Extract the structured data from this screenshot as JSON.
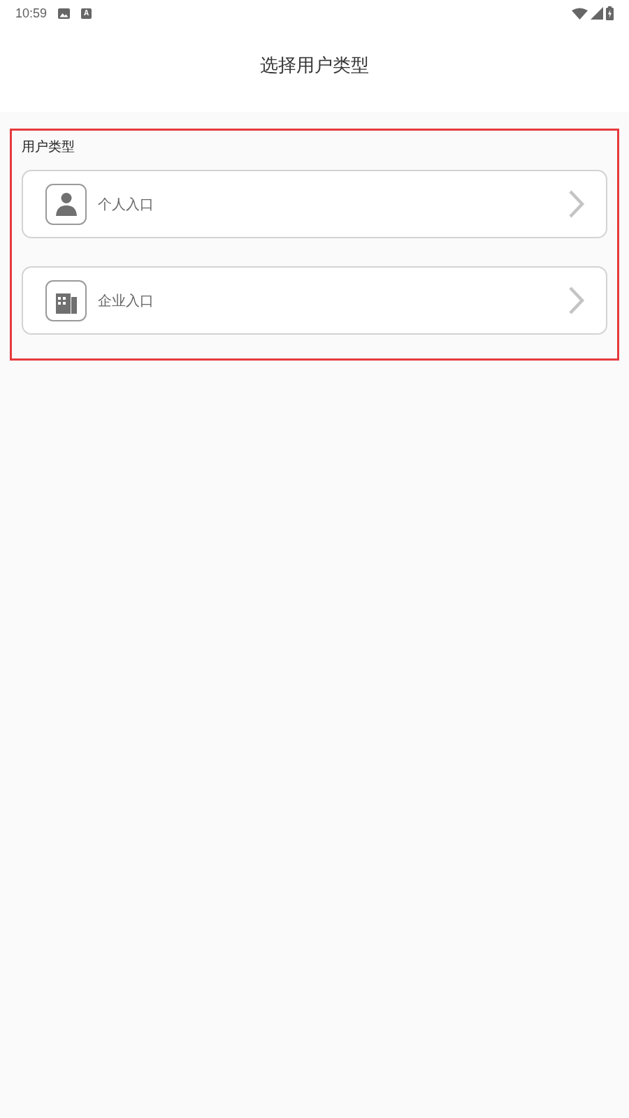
{
  "status_bar": {
    "time": "10:59",
    "notifications": [
      {
        "kind": "picture"
      },
      {
        "kind": "letter",
        "text": "A"
      }
    ]
  },
  "header": {
    "title": "选择用户类型"
  },
  "section": {
    "title": "用户类型",
    "options": [
      {
        "kind": "person",
        "label": "个人入口"
      },
      {
        "kind": "enterprise",
        "label": "企业入口"
      }
    ]
  }
}
